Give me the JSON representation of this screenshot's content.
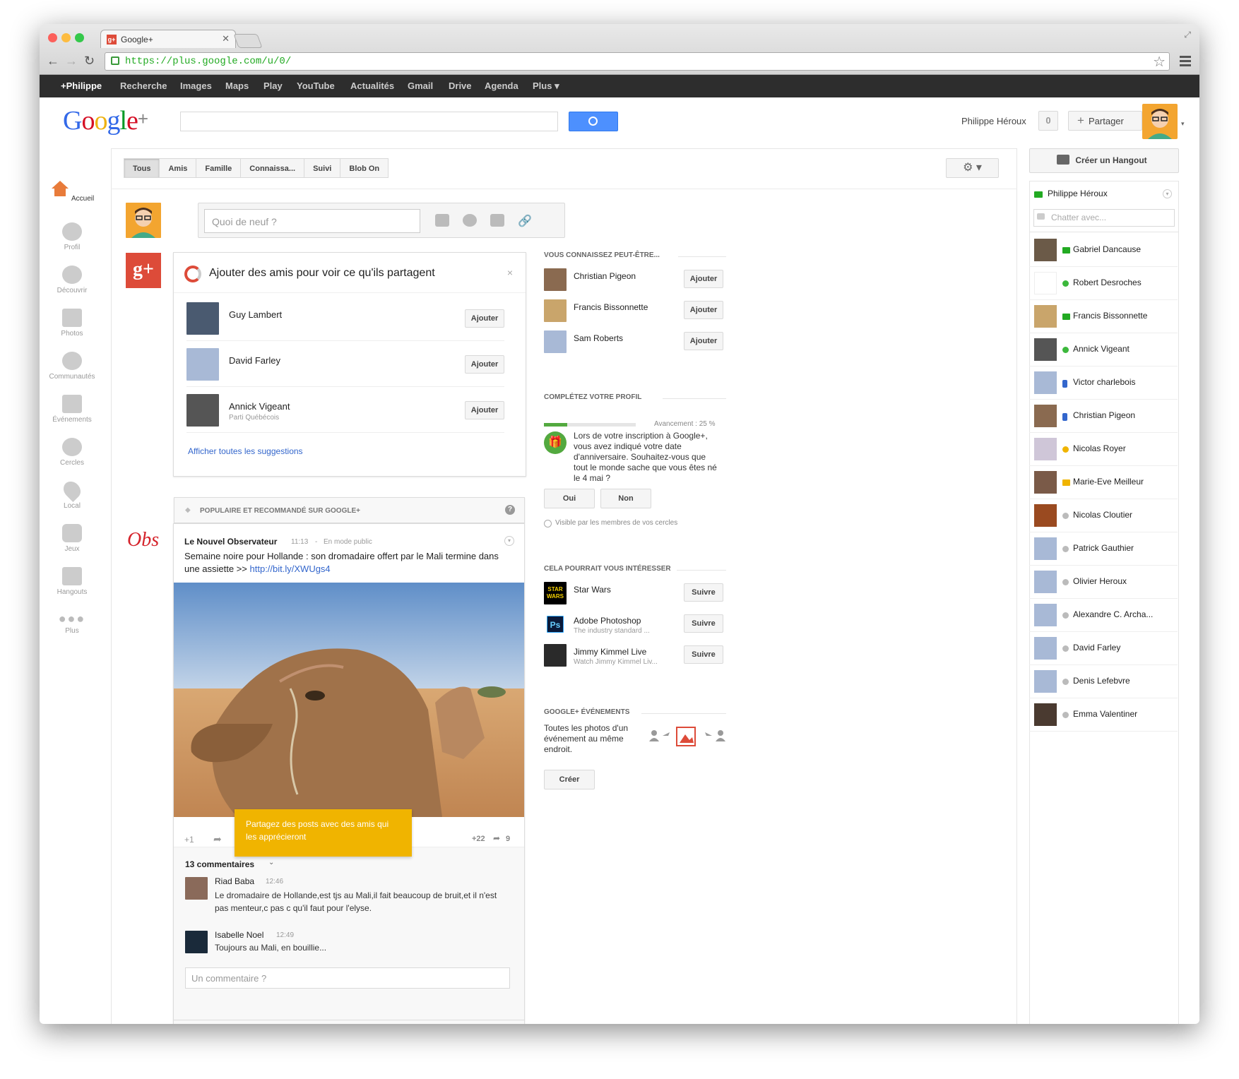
{
  "browser": {
    "tab_title": "Google+",
    "tab_favicon": "g+",
    "url": "https://plus.google.com/u/0/"
  },
  "gbar": [
    "+Philippe",
    "Recherche",
    "Images",
    "Maps",
    "Play",
    "YouTube",
    "Actualités",
    "Gmail",
    "Drive",
    "Agenda",
    "Plus ▾"
  ],
  "header": {
    "logo": "Google+",
    "user_name": "Philippe Héroux",
    "notifications": "0",
    "share_label": "Partager",
    "share_icon": "+"
  },
  "sidenav": [
    {
      "label": "Accueil",
      "icon": "home-icon",
      "active": true
    },
    {
      "label": "Profil",
      "icon": "profile-icon"
    },
    {
      "label": "Découvrir",
      "icon": "compass-icon"
    },
    {
      "label": "Photos",
      "icon": "camera-icon"
    },
    {
      "label": "Communautés",
      "icon": "communities-icon"
    },
    {
      "label": "Événements",
      "icon": "calendar-icon"
    },
    {
      "label": "Cercles",
      "icon": "circles-icon"
    },
    {
      "label": "Local",
      "icon": "pin-icon"
    },
    {
      "label": "Jeux",
      "icon": "games-icon"
    },
    {
      "label": "Hangouts",
      "icon": "hangouts-icon"
    },
    {
      "label": "Plus",
      "icon": "more-icon"
    }
  ],
  "filter_tabs": [
    "Tous",
    "Amis",
    "Famille",
    "Connaissa...",
    "Suivi",
    "Blob On"
  ],
  "composer": {
    "placeholder": "Quoi de neuf ?"
  },
  "suggestions": {
    "title": "Ajouter des amis pour voir ce qu'ils partagent",
    "close": "×",
    "people": [
      {
        "name": "Guy Lambert",
        "sub": "",
        "button": "Ajouter"
      },
      {
        "name": "David Farley",
        "sub": "",
        "button": "Ajouter"
      },
      {
        "name": "Annick Vigeant",
        "sub": "Parti Québécois",
        "button": "Ajouter"
      }
    ],
    "show_all": "Afficher toutes les suggestions"
  },
  "popular": {
    "header": "POPULAIRE ET RECOMMANDÉ SUR GOOGLE+",
    "help": "?",
    "source_logo": "Obs",
    "author": "Le Nouvel Observateur",
    "time": "11:13",
    "visibility": "En mode public",
    "text": "Semaine noire pour Hollande : son dromadaire offert par le Mali termine dans une assiette >> ",
    "link": "http://bit.ly/XWUgs4",
    "plus_one": "+1",
    "plus_count": "+22",
    "share_count": "9",
    "tooltip": "Partagez des posts avec des amis qui les apprécieront",
    "comments_count": "13 commentaires",
    "comments": [
      {
        "author": "Riad Baba",
        "time": "12:46",
        "text": "Le dromadaire de Hollande,est tjs au Mali,il fait beaucoup de bruit,et il n'est pas menteur,c pas c qu'il faut pour l'elyse."
      },
      {
        "author": "Isabelle Noel",
        "time": "12:49",
        "text": "Toujours au Mali, en bouillie..."
      }
    ],
    "comment_placeholder": "Un commentaire ?"
  },
  "pymk": {
    "title": "VOUS CONNAISSEZ PEUT-ÊTRE...",
    "people": [
      {
        "name": "Christian Pigeon",
        "button": "Ajouter"
      },
      {
        "name": "Francis Bissonnette",
        "button": "Ajouter"
      },
      {
        "name": "Sam Roberts",
        "button": "Ajouter"
      }
    ]
  },
  "profile": {
    "title": "COMPLÉTEZ VOTRE PROFIL",
    "progress_label": "Avancement : 25 %",
    "progress": 0.25,
    "text": "Lors de votre inscription à Google+, vous avez indiqué votre date d'anniversaire. Souhaitez-vous que tout le monde sache que vous êtes né le 4 mai ?",
    "yes": "Oui",
    "no": "Non",
    "visibility": "Visible par les membres de vos cercles"
  },
  "interests": {
    "title": "CELA POURRAIT VOUS INTÉRESSER",
    "items": [
      {
        "name": "Star Wars",
        "sub": "",
        "button": "Suivre",
        "logo": "STAR WARS"
      },
      {
        "name": "Adobe Photoshop",
        "sub": "The industry standard ...",
        "button": "Suivre",
        "logo": "Ps"
      },
      {
        "name": "Jimmy Kimmel Live",
        "sub": "Watch Jimmy Kimmel Liv...",
        "button": "Suivre",
        "logo": ""
      }
    ]
  },
  "events": {
    "title": "GOOGLE+ ÉVÉNEMENTS",
    "text": "Toutes les photos d'un événement au même endroit.",
    "button": "Créer"
  },
  "chat": {
    "hangout_button": "Créer un Hangout",
    "me": "Philippe Héroux",
    "search_placeholder": "Chatter avec...",
    "contacts": [
      {
        "name": "Gabriel Dancause",
        "status": "video",
        "color": "#22aa22",
        "avatar": "#6b5a48"
      },
      {
        "name": "Robert Desroches",
        "status": "online",
        "color": "#3cb83c",
        "avatar": "#ffffff"
      },
      {
        "name": "Francis Bissonnette",
        "status": "video",
        "color": "#22aa22",
        "avatar": "#c9a56b"
      },
      {
        "name": "Annick Vigeant",
        "status": "online",
        "color": "#3cb83c",
        "avatar": "#555555"
      },
      {
        "name": "Victor charlebois",
        "status": "mobile",
        "color": "#3366cc",
        "avatar": "#a8b9d6"
      },
      {
        "name": "Christian Pigeon",
        "status": "mobile",
        "color": "#3366cc",
        "avatar": "#8a6a50"
      },
      {
        "name": "Nicolas Royer",
        "status": "away",
        "color": "#f0b400",
        "avatar": "#cfc6d8"
      },
      {
        "name": "Marie-Eve Meilleur",
        "status": "video-away",
        "color": "#f0b400",
        "avatar": "#7a5a48"
      },
      {
        "name": "Nicolas Cloutier",
        "status": "offline",
        "color": "#bbbbbb",
        "avatar": "#9a4a20"
      },
      {
        "name": "Patrick Gauthier",
        "status": "offline",
        "color": "#bbbbbb",
        "avatar": "#a8b9d6"
      },
      {
        "name": "Olivier Heroux",
        "status": "offline",
        "color": "#bbbbbb",
        "avatar": "#a8b9d6"
      },
      {
        "name": "Alexandre C. Archa...",
        "status": "offline",
        "color": "#bbbbbb",
        "avatar": "#a8b9d6"
      },
      {
        "name": "David Farley",
        "status": "offline",
        "color": "#bbbbbb",
        "avatar": "#a8b9d6"
      },
      {
        "name": "Denis Lefebvre",
        "status": "offline",
        "color": "#bbbbbb",
        "avatar": "#a8b9d6"
      },
      {
        "name": "Emma Valentiner",
        "status": "offline",
        "color": "#bbbbbb",
        "avatar": "#4a3a30"
      }
    ]
  },
  "colors": {
    "accent": "#dd4b39",
    "link": "#3366cc",
    "tooltip": "#f0b400",
    "search": "#4d90fe"
  }
}
